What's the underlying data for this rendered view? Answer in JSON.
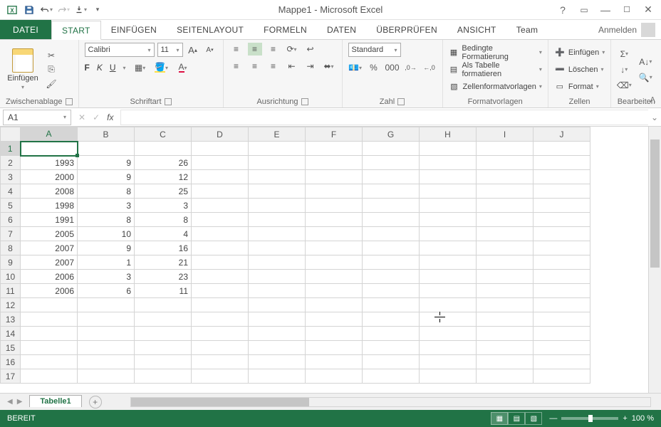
{
  "title": "Mappe1 - Microsoft Excel",
  "signin": "Anmelden",
  "tabs": {
    "file": "DATEI",
    "start": "START",
    "einf": "EINFÜGEN",
    "layout": "SEITENLAYOUT",
    "form": "FORMELN",
    "daten": "DATEN",
    "uber": "ÜBERPRÜFEN",
    "ans": "ANSICHT",
    "team": "Team"
  },
  "groups": {
    "clip": "Zwischenablage",
    "font": "Schriftart",
    "align": "Ausrichtung",
    "num": "Zahl",
    "styles": "Formatvorlagen",
    "cells": "Zellen",
    "edit": "Bearbeiten"
  },
  "paste": "Einfügen",
  "font": {
    "name": "Calibri",
    "size": "11"
  },
  "numfmt": "Standard",
  "styleBtns": {
    "cond": "Bedingte Formatierung",
    "table": "Als Tabelle formatieren",
    "cell": "Zellenformatvorlagen"
  },
  "cellBtns": {
    "ins": "Einfügen",
    "del": "Löschen",
    "fmt": "Format"
  },
  "nameBox": "A1",
  "columns": [
    "A",
    "B",
    "C",
    "D",
    "E",
    "F",
    "G",
    "H",
    "I",
    "J"
  ],
  "rows": [
    1,
    2,
    3,
    4,
    5,
    6,
    7,
    8,
    9,
    10,
    11,
    12,
    13,
    14,
    15,
    16,
    17
  ],
  "cells": {
    "2": {
      "A": "1993",
      "B": "9",
      "C": "26"
    },
    "3": {
      "A": "2000",
      "B": "9",
      "C": "12"
    },
    "4": {
      "A": "2008",
      "B": "8",
      "C": "25"
    },
    "5": {
      "A": "1998",
      "B": "3",
      "C": "3"
    },
    "6": {
      "A": "1991",
      "B": "8",
      "C": "8"
    },
    "7": {
      "A": "2005",
      "B": "10",
      "C": "4"
    },
    "8": {
      "A": "2007",
      "B": "9",
      "C": "16"
    },
    "9": {
      "A": "2007",
      "B": "1",
      "C": "21"
    },
    "10": {
      "A": "2006",
      "B": "3",
      "C": "23"
    },
    "11": {
      "A": "2006",
      "B": "6",
      "C": "11"
    }
  },
  "sheet": "Tabelle1",
  "status": "BEREIT",
  "zoom": "100 %"
}
